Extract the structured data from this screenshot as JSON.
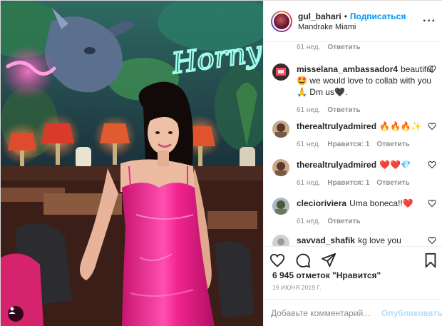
{
  "header": {
    "username": "gul_bahari",
    "separator": "•",
    "follow_label": "Подписаться",
    "location": "Mandrake Miami",
    "more_icon": "more-horizontal-icon"
  },
  "photo": {
    "neon_sign_text": "Horny",
    "tag_icon": "user-tag-icon"
  },
  "comments": {
    "top_meta": {
      "age": "61 нед.",
      "reply": "Ответить"
    },
    "items": [
      {
        "username": "misselana_ambassador4",
        "text": "beautiful 🤩 we would love to collab with you🙏 Dm us🖤.",
        "age": "61 нед.",
        "likes": "",
        "reply": "Ответить"
      },
      {
        "username": "therealtrulyadmired",
        "text": "🔥🔥🔥✨",
        "age": "61 нед.",
        "likes": "Нравится: 1",
        "reply": "Ответить"
      },
      {
        "username": "therealtrulyadmired",
        "text": "❤️❤️💎",
        "age": "61 нед.",
        "likes": "Нравится: 1",
        "reply": "Ответить"
      },
      {
        "username": "clecioriviera",
        "text": "Uma boneca!!❤️",
        "age": "61 нед.",
        "likes": "",
        "reply": "Ответить"
      },
      {
        "username": "savvad_shafik",
        "text": "kg love you baby",
        "age": "",
        "likes": "",
        "reply": ""
      }
    ]
  },
  "actions": {
    "like_icon": "heart-icon",
    "comment_icon": "comment-icon",
    "share_icon": "share-icon",
    "save_icon": "bookmark-icon"
  },
  "likes_text": "6 945 отметок \"Нравится\"",
  "date_text": "19 ИЮНЯ 2019 Г.",
  "add_comment": {
    "placeholder": "Добавьте комментарий...",
    "publish_label": "Опубликовать"
  },
  "colors": {
    "accent": "#0095f6",
    "publish_disabled": "#b2dffc",
    "muted": "#8e8e8e",
    "neon_pink": "#ff3fa8",
    "neon_teal": "#7ff7e2",
    "dress_pink": "#f2248f"
  }
}
